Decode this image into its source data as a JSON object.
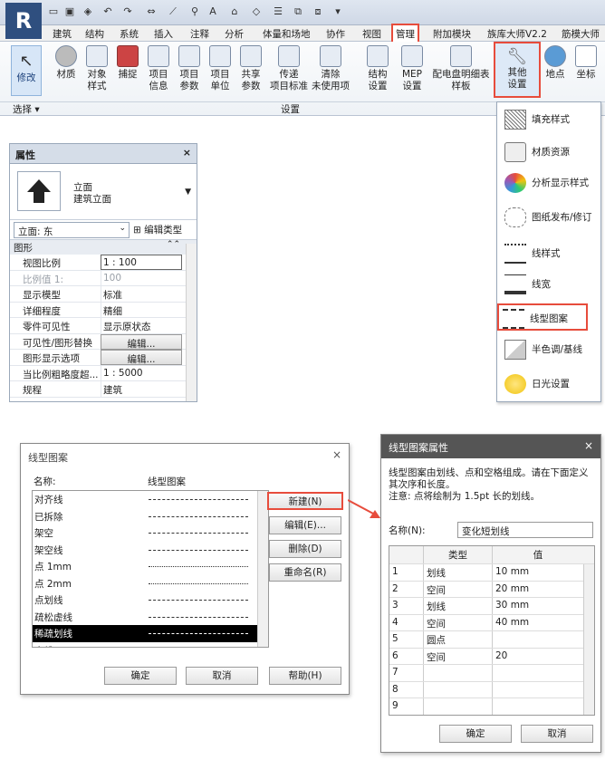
{
  "ribbon": {
    "tabs": [
      "建筑",
      "结构",
      "系统",
      "插入",
      "注释",
      "分析",
      "体量和场地",
      "协作",
      "视图",
      "管理",
      "附加模块",
      "族库大师V2.2",
      "筋模大师"
    ],
    "active_tab": "管理",
    "modify": "修改",
    "buttons": [
      {
        "l1": "材质",
        "l2": ""
      },
      {
        "l1": "对象",
        "l2": "样式"
      },
      {
        "l1": "捕捉",
        "l2": ""
      },
      {
        "l1": "项目",
        "l2": "信息"
      },
      {
        "l1": "项目",
        "l2": "参数"
      },
      {
        "l1": "项目",
        "l2": "单位"
      },
      {
        "l1": "共享",
        "l2": "参数"
      },
      {
        "l1": "传递",
        "l2": "项目标准"
      },
      {
        "l1": "清除",
        "l2": "未使用项"
      },
      {
        "l1": "结构",
        "l2": "设置"
      },
      {
        "l1": "MEP",
        "l2": "设置"
      },
      {
        "l1": "配电盘明细表",
        "l2": "样板"
      }
    ],
    "other_settings": {
      "l1": "其他",
      "l2": "设置"
    },
    "location": "地点",
    "coordinates": "坐标",
    "group_select": "选择 ▾",
    "group_settings": "设置"
  },
  "dropdown": [
    "填充样式",
    "材质资源",
    "分析显示样式",
    "图纸发布/修订",
    "线样式",
    "线宽",
    "线型图案",
    "半色调/基线",
    "日光设置"
  ],
  "properties": {
    "title": "属性",
    "close": "×",
    "type_line1": "立面",
    "type_line2": "建筑立面",
    "instance": "立面: 东",
    "edit_type": "编辑类型",
    "category": "图形",
    "rows": [
      {
        "k": "视图比例",
        "v": "1 : 100"
      },
      {
        "k": "比例值 1:",
        "v": "100"
      },
      {
        "k": "显示模型",
        "v": "标准"
      },
      {
        "k": "详细程度",
        "v": "精细"
      },
      {
        "k": "零件可见性",
        "v": "显示原状态"
      },
      {
        "k": "可见性/图形替换",
        "v": "编辑..."
      },
      {
        "k": "图形显示选项",
        "v": "编辑..."
      },
      {
        "k": "当比例粗略度超...",
        "v": "1 : 5000"
      },
      {
        "k": "规程",
        "v": "建筑"
      }
    ]
  },
  "dialog_patterns": {
    "title": "线型图案",
    "close": "×",
    "col_name": "名称:",
    "col_pattern": "线型图案",
    "items": [
      "对齐线",
      "已拆除",
      "架空",
      "架空线",
      "点 1mm",
      "点 2mm",
      "点划线",
      "疏松虚线",
      "稀疏划线",
      "虚线"
    ],
    "selected": "稀疏划线",
    "btn_new": "新建(N)",
    "btn_edit": "编辑(E)...",
    "btn_delete": "删除(D)",
    "btn_rename": "重命名(R)",
    "btn_ok": "确定",
    "btn_cancel": "取消",
    "btn_help": "帮助(H)"
  },
  "dialog_props": {
    "title": "线型图案属性",
    "close": "×",
    "desc1": "线型图案由划线、点和空格组成。请在下面定义其次序和长度。",
    "desc2": "注意: 点将绘制为 1.5pt 长的划线。",
    "name_label": "名称(N):",
    "name_value": "变化短划线",
    "col_type": "类型",
    "col_value": "值",
    "rows": [
      {
        "n": "1",
        "t": "划线",
        "v": "10 mm"
      },
      {
        "n": "2",
        "t": "空间",
        "v": "20 mm"
      },
      {
        "n": "3",
        "t": "划线",
        "v": "30 mm"
      },
      {
        "n": "4",
        "t": "空间",
        "v": "40 mm"
      },
      {
        "n": "5",
        "t": "圆点",
        "v": ""
      },
      {
        "n": "6",
        "t": "空间",
        "v": "20"
      },
      {
        "n": "7",
        "t": "",
        "v": ""
      },
      {
        "n": "8",
        "t": "",
        "v": ""
      },
      {
        "n": "9",
        "t": "",
        "v": ""
      }
    ],
    "btn_ok": "确定",
    "btn_cancel": "取消"
  },
  "colors": {
    "highlight": "#e74c3c",
    "accent": "#2f4f7f"
  }
}
